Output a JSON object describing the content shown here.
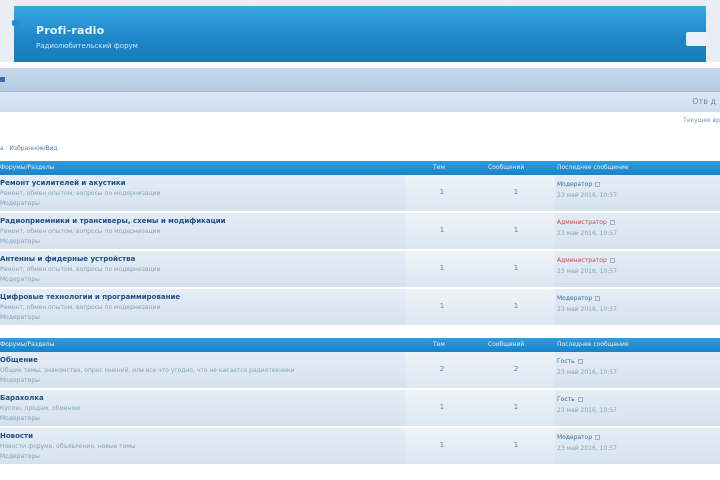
{
  "header": {
    "site_title": "Profi-radio",
    "site_description": "Радиолюбительский форум"
  },
  "subbar": {
    "right_text": "Отв д"
  },
  "meta": {
    "right_text": "Текущее вр"
  },
  "breadcrumb": {
    "text": "а · Избранное/Вид"
  },
  "columns": {
    "forum": "Форумы/Разделы",
    "topics": "Тем",
    "posts": "Сообщений",
    "last_post": "Последнее сообщение"
  },
  "section1": {
    "rows": [
      {
        "title": "Ремонт усилителей и акустики",
        "desc": "Ремонт, обмен опытом, вопросы по модернизации",
        "mods": "Модераторы",
        "topics": "1",
        "posts": "1",
        "last_user": "Модератор",
        "last_user_red": false,
        "last_date": "23 май 2016, 10:57"
      },
      {
        "title": "Радиоприемники и трансиверы, схемы и модификации",
        "desc": "Ремонт, обмен опытом, вопросы по модернизации",
        "mods": "Модераторы",
        "topics": "1",
        "posts": "1",
        "last_user": "Администратор",
        "last_user_red": true,
        "last_date": "23 май 2016, 10:57"
      },
      {
        "title": "Антенны и фидерные устройства",
        "desc": "Ремонт, обмен опытом, вопросы по модернизации",
        "mods": "Модераторы",
        "topics": "1",
        "posts": "1",
        "last_user": "Администратор",
        "last_user_red": true,
        "last_date": "23 май 2016, 10:57"
      },
      {
        "title": "Цифровые технологии и программирование",
        "desc": "Ремонт, обмен опытом, вопросы по модернизации",
        "mods": "Модераторы",
        "topics": "1",
        "posts": "1",
        "last_user": "Модератор",
        "last_user_red": false,
        "last_date": "23 май 2016, 10:57"
      }
    ]
  },
  "section2": {
    "rows": [
      {
        "title": "Общение",
        "desc": "Общие темы, знакомства, опрос мнений, или все что угодно, что не касается радиотехники",
        "mods": "Модераторы",
        "topics": "2",
        "posts": "2",
        "last_user": "Гость",
        "last_user_red": false,
        "last_date": "23 май 2016, 10:57"
      },
      {
        "title": "Барахолка",
        "desc": "Куплю, продам, обменяю",
        "mods": "Модераторы",
        "topics": "1",
        "posts": "1",
        "last_user": "Гость",
        "last_user_red": false,
        "last_date": "23 май 2016, 10:57"
      },
      {
        "title": "Новости",
        "desc": "Новости форума, объявления, новые темы",
        "mods": "Модераторы",
        "topics": "1",
        "posts": "1",
        "last_user": "Модератор",
        "last_user_red": false,
        "last_date": "23 май 2016, 10:57"
      }
    ]
  }
}
